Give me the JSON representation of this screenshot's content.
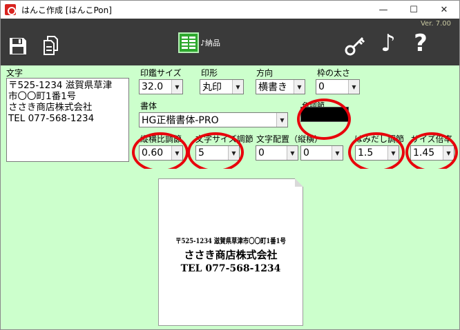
{
  "window": {
    "title": "はんこ作成 [はんこPon]"
  },
  "toolbar": {
    "version": "Ver. 7.00",
    "nouhin_label": "♪納品"
  },
  "form": {
    "moji_label": "文字",
    "moji_value": "〒525-1234 滋賀県草津\n市〇〇町1番1号\nささき商店株式会社\nTEL 077-568-1234",
    "inkan_size": {
      "label": "印鑑サイズ",
      "value": "32.0"
    },
    "ingata": {
      "label": "印形",
      "value": "丸印"
    },
    "houkou": {
      "label": "方向",
      "value": "横書き"
    },
    "waku": {
      "label": "枠の太さ",
      "value": "0"
    },
    "shotai": {
      "label": "書体",
      "value": "HG正楷書体-PRO"
    },
    "color": {
      "label": "色調節",
      "value": "#000000"
    },
    "aspect": {
      "label": "縦横比調節",
      "value": "0.60"
    },
    "moji_size": {
      "label": "文字サイズ調節",
      "value": "5"
    },
    "moji_haichi": {
      "label": "文字配置（縦横）",
      "value1": "0",
      "value2": "0"
    },
    "hamidashi": {
      "label": "はみだし調節",
      "value": "1.5"
    },
    "size_bairitsu": {
      "label": "サイズ倍率",
      "value": "1.45"
    }
  },
  "preview": {
    "line1": "〒525-1234 滋賀県草津市〇〇町1番1号",
    "line2": "ささき商店株式会社",
    "line3": "TEL 077-568-1234"
  },
  "colors": {
    "highlight": "#e8000b",
    "background": "#ccffcc",
    "toolbar": "#3a3a3a"
  }
}
